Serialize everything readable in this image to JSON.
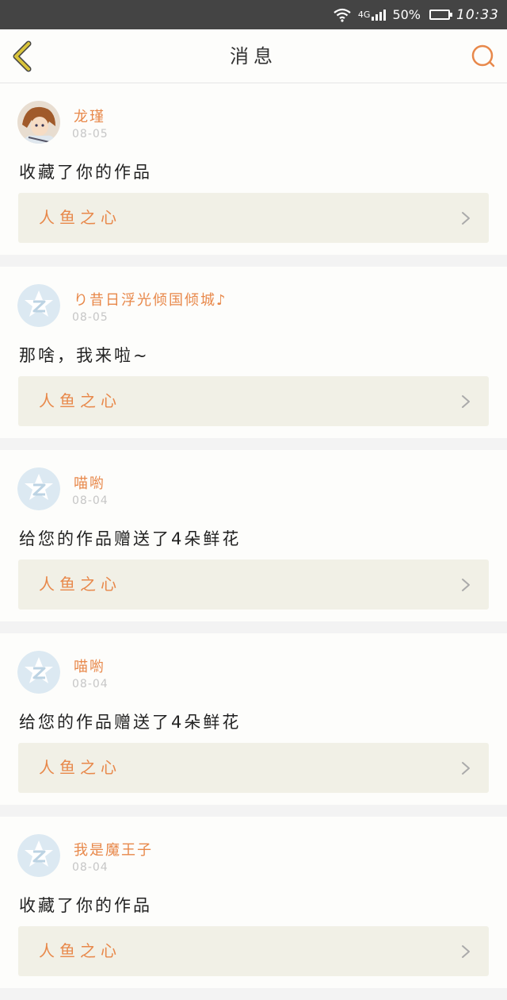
{
  "status_bar": {
    "network": "4G",
    "battery_percent": "50%",
    "battery_level": 0.5,
    "time": "10:33"
  },
  "header": {
    "title": "消息",
    "back_icon": "chevron-left-icon",
    "search_icon": "search-icon"
  },
  "colors": {
    "accent": "#e8884a",
    "back_icon": "#d9c43b",
    "card_link_bg": "#f1f0e6"
  },
  "messages": [
    {
      "username": "龙瑾",
      "date": "08-05",
      "text": "收藏了你的作品",
      "work_title": "人鱼之心",
      "avatar": "anime-avatar"
    },
    {
      "username": "り昔日浮光倾国倾城♪",
      "date": "08-05",
      "text": "那啥，我来啦~",
      "work_title": "人鱼之心",
      "avatar": "default-avatar"
    },
    {
      "username": "喵喲",
      "date": "08-04",
      "text": "给您的作品赠送了4朵鲜花",
      "work_title": "人鱼之心",
      "avatar": "default-avatar"
    },
    {
      "username": "喵喲",
      "date": "08-04",
      "text": "给您的作品赠送了4朵鲜花",
      "work_title": "人鱼之心",
      "avatar": "default-avatar"
    },
    {
      "username": "我是魔王子",
      "date": "08-04",
      "text": "收藏了你的作品",
      "work_title": "人鱼之心",
      "avatar": "default-avatar"
    }
  ]
}
